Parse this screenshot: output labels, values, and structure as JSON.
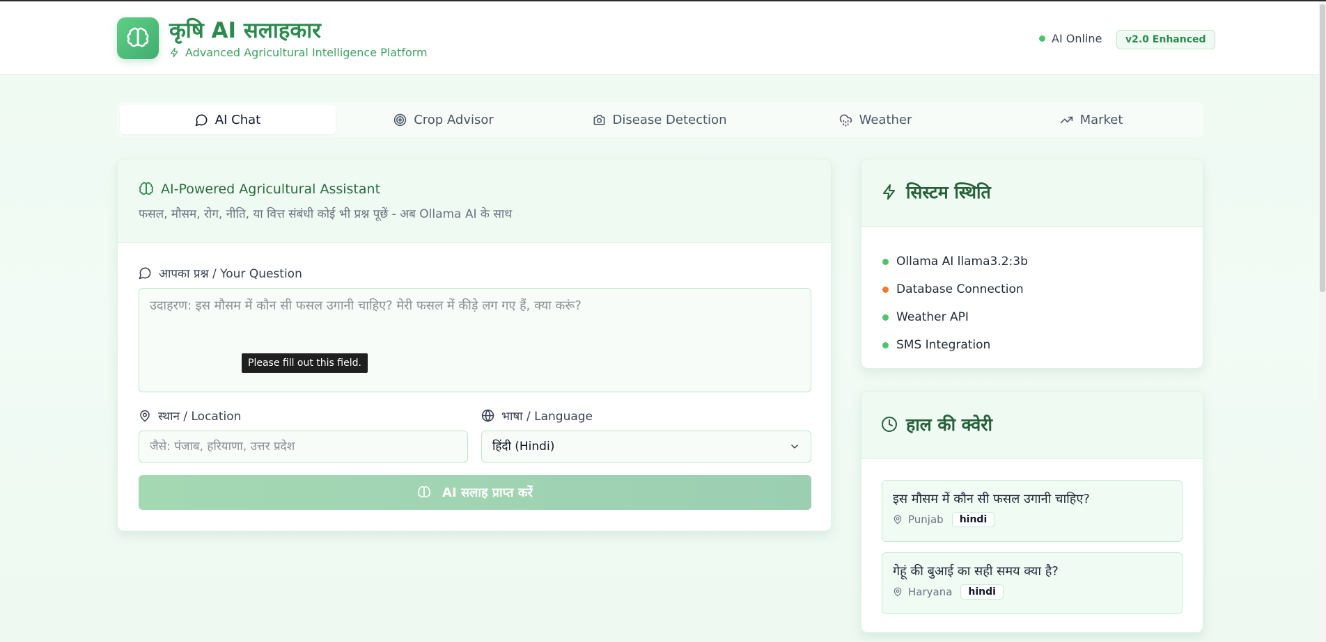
{
  "header": {
    "title": "कृषि AI सलाहकार",
    "subtitle": "Advanced Agricultural Intelligence Platform",
    "status_text": "AI Online",
    "version_badge": "v2.0 Enhanced"
  },
  "tabs": [
    {
      "label": "AI Chat",
      "icon": "chat-icon",
      "active": true
    },
    {
      "label": "Crop Advisor",
      "icon": "target-icon",
      "active": false
    },
    {
      "label": "Disease Detection",
      "icon": "camera-icon",
      "active": false
    },
    {
      "label": "Weather",
      "icon": "cloud-rain-icon",
      "active": false
    },
    {
      "label": "Market",
      "icon": "trending-up-icon",
      "active": false
    }
  ],
  "chat": {
    "title": "AI-Powered Agricultural Assistant",
    "subtitle": "फसल, मौसम, रोग, नीति, या वित्त संबंधी कोई भी प्रश्न पूछें - अब Ollama AI के साथ",
    "question_label": "आपका प्रश्न / Your Question",
    "question_placeholder": "उदाहरण: इस मौसम में कौन सी फसल उगानी चाहिए? मेरी फसल में कीड़े लग गए हैं, क्या करूं?",
    "validation_tooltip": "Please fill out this field.",
    "location_label": "स्थान / Location",
    "location_placeholder": "जैसे: पंजाब, हरियाणा, उत्तर प्रदेश",
    "language_label": "भाषा / Language",
    "language_selected": "हिंदी (Hindi)",
    "submit_label": "AI सलाह प्राप्त करें"
  },
  "system_status": {
    "title": "सिस्टम स्थिति",
    "items": [
      {
        "label": "Ollama AI llama3.2:3b",
        "color": "#4cc46c"
      },
      {
        "label": "Database Connection",
        "color": "#f07b2e"
      },
      {
        "label": "Weather API",
        "color": "#4cc46c"
      },
      {
        "label": "SMS Integration",
        "color": "#4cc46c"
      }
    ]
  },
  "recent_queries": {
    "title": "हाल की क्वेरी",
    "items": [
      {
        "question": "इस मौसम में कौन सी फसल उगानी चाहिए?",
        "location": "Punjab",
        "language": "hindi"
      },
      {
        "question": "गेहूं की बुआई का सही समय क्या है?",
        "location": "Haryana",
        "language": "hindi"
      }
    ]
  },
  "colors": {
    "brand": "#2d8a4e",
    "accent": "#4cc46c",
    "warning": "#f07b2e",
    "panel_tint": "#eefaf2"
  }
}
